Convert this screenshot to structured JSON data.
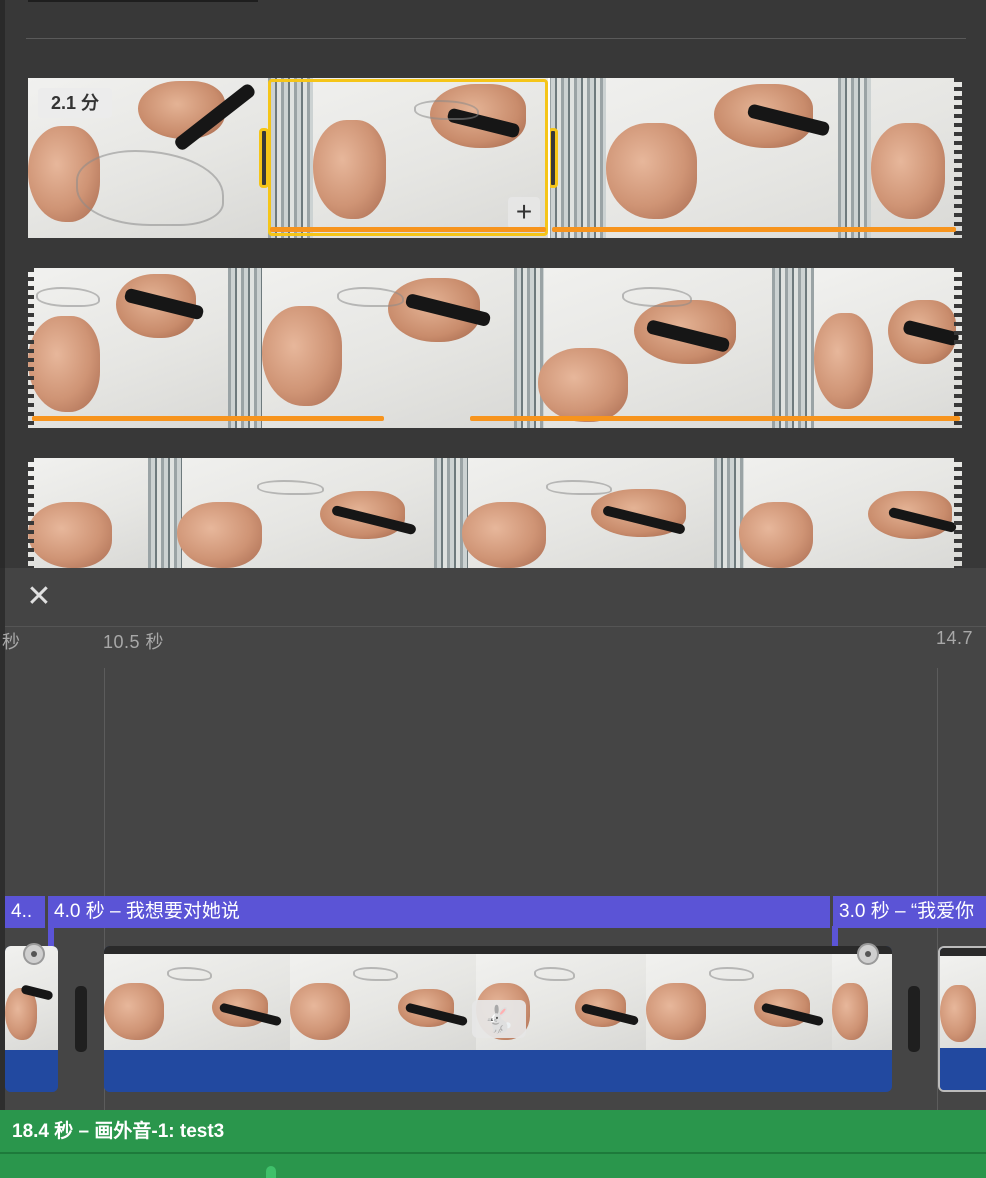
{
  "browser": {
    "duration_badge": "2.1 分",
    "add_button": "+"
  },
  "timeline": {
    "close_icon": "✕",
    "ruler": {
      "left_cut": "秒",
      "start": "10.5 秒",
      "end": "14.7"
    },
    "titles": {
      "left": "4..",
      "main": "4.0 秒 – 我想要对她说",
      "right": "3.0 秒 – “我爱你"
    },
    "speed_icon": "🐇",
    "audio_label": "18.4 秒 – 画外音-1: test3"
  },
  "colors": {
    "selection": "#f5c518",
    "favorite_line": "#f7941d",
    "title_track": "#5b54d6",
    "video_track": "#2249a0",
    "audio_track": "#2a964c"
  }
}
